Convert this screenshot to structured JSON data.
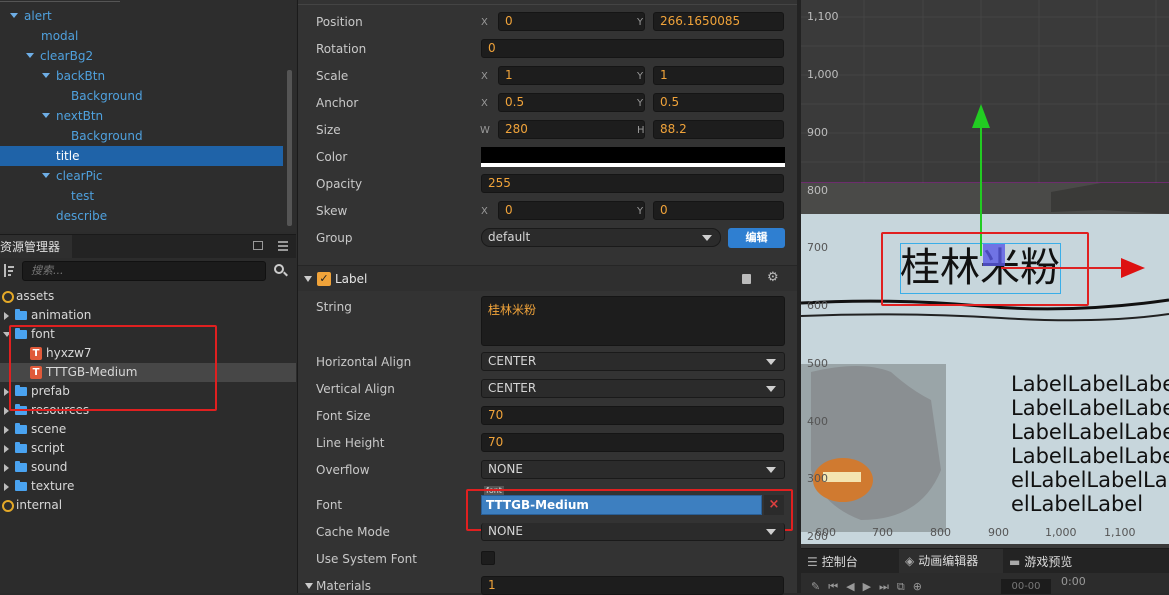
{
  "hierarchy": {
    "items": [
      {
        "label": "alert",
        "depth": 0,
        "expanded": true
      },
      {
        "label": "modal",
        "depth": 1,
        "expanded": false
      },
      {
        "label": "clearBg2",
        "depth": 1,
        "expanded": true
      },
      {
        "label": "backBtn",
        "depth": 2,
        "expanded": true
      },
      {
        "label": "Background",
        "depth": 3,
        "expanded": false
      },
      {
        "label": "nextBtn",
        "depth": 2,
        "expanded": true
      },
      {
        "label": "Background",
        "depth": 3,
        "expanded": false
      },
      {
        "label": "title",
        "depth": 2,
        "expanded": false,
        "selected": true
      },
      {
        "label": "clearPic",
        "depth": 2,
        "expanded": true
      },
      {
        "label": "test",
        "depth": 3,
        "expanded": false
      },
      {
        "label": "describe",
        "depth": 2,
        "expanded": false
      }
    ]
  },
  "assets": {
    "tab_label": "资源管理器",
    "search_placeholder": "搜索...",
    "items": [
      {
        "label": "assets",
        "type": "db"
      },
      {
        "label": "animation",
        "type": "folder"
      },
      {
        "label": "font",
        "type": "folder",
        "expanded": true
      },
      {
        "label": "hyxzw7",
        "type": "font"
      },
      {
        "label": "TTTGB-Medium",
        "type": "font",
        "selected": true
      },
      {
        "label": "prefab",
        "type": "folder"
      },
      {
        "label": "resources",
        "type": "folder"
      },
      {
        "label": "scene",
        "type": "folder"
      },
      {
        "label": "script",
        "type": "folder"
      },
      {
        "label": "sound",
        "type": "folder"
      },
      {
        "label": "texture",
        "type": "folder"
      },
      {
        "label": "internal",
        "type": "db"
      }
    ]
  },
  "node": {
    "position_label": "Position",
    "position_x": "0",
    "position_y": "266.1650085",
    "rotation_label": "Rotation",
    "rotation": "0",
    "scale_label": "Scale",
    "scale_x": "1",
    "scale_y": "1",
    "anchor_label": "Anchor",
    "anchor_x": "0.5",
    "anchor_y": "0.5",
    "size_label": "Size",
    "size_w": "280",
    "size_h": "88.2",
    "color_label": "Color",
    "color_value": "#000000",
    "opacity_label": "Opacity",
    "opacity": "255",
    "skew_label": "Skew",
    "skew_x": "0",
    "skew_y": "0",
    "group_label": "Group",
    "group": "default",
    "edit_button": "编辑",
    "axis_x": "X",
    "axis_y": "Y",
    "axis_w": "W",
    "axis_h": "H"
  },
  "label_component": {
    "title": "Label",
    "string_label": "String",
    "string": "桂林米粉",
    "halign_label": "Horizontal Align",
    "halign": "CENTER",
    "valign_label": "Vertical Align",
    "valign": "CENTER",
    "font_size_label": "Font Size",
    "font_size": "70",
    "line_height_label": "Line Height",
    "line_height": "70",
    "overflow_label": "Overflow",
    "overflow": "NONE",
    "font_label": "Font",
    "font": "TTTGB-Medium",
    "font_tag": "font",
    "cache_mode_label": "Cache Mode",
    "cache_mode": "NONE",
    "system_font_label": "Use System Font",
    "materials_label": "Materials",
    "materials": "1"
  },
  "scene": {
    "y_ticks": [
      "1,100",
      "1,000",
      "900",
      "800",
      "700",
      "600",
      "500",
      "400",
      "300",
      "200"
    ],
    "x_ticks": [
      "600",
      "700",
      "800",
      "900",
      "1,000",
      "1,100"
    ],
    "title_text": "桂林米粉",
    "label_lines": [
      "LabelLabelLabe",
      "LabelLabelLabe",
      "LabelLabelLabe",
      "LabelLabelLabe",
      "elLabelLabelLa",
      "elLabelLabel"
    ]
  },
  "bottom_tabs": [
    {
      "label": "控制台",
      "icon": "console-icon"
    },
    {
      "label": "动画编辑器",
      "icon": "animation-icon"
    },
    {
      "label": "游戏预览",
      "icon": "preview-icon"
    }
  ],
  "timeline": {
    "frame": "00-00",
    "time": "0:00"
  },
  "colors": {
    "accent": "#1f63a8",
    "value": "#f0a33a",
    "highlight": "#e02020",
    "link": "#4fa1de"
  }
}
